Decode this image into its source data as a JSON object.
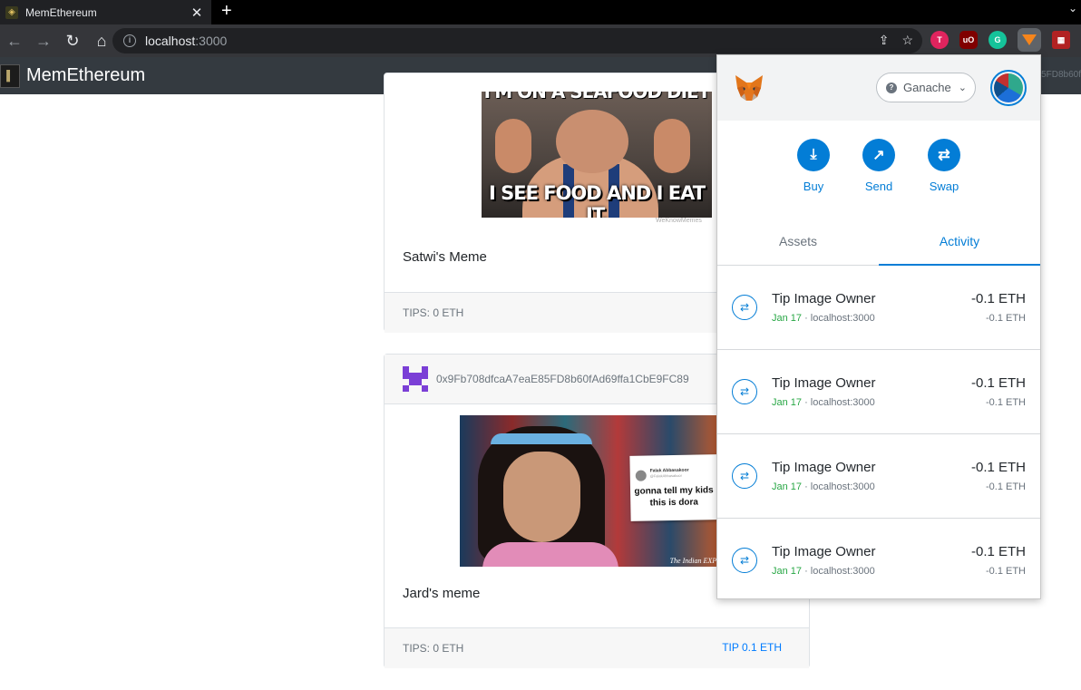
{
  "browser": {
    "tab_title": "MemEthereum",
    "tab_close": "✕",
    "new_tab": "+",
    "url_host": "localhost",
    "url_port": ":3000"
  },
  "app": {
    "brand": "MemEthereum",
    "nav_account_fragment": "5FD8b60f"
  },
  "posts": [
    {
      "meme_top_text": "I'M ON A SEAFOOD DIET",
      "meme_text": "I SEE FOOD AND I EAT IT.",
      "watermark": "WeKnowMemes",
      "caption": "Satwi's Meme",
      "tips": "TIPS: 0 ETH"
    },
    {
      "author_address": "0x9Fb708dfcaA7eaE85FD8b60fAd69ffa1CbE9FC89",
      "tweet_name": "Falak Abbasakoor",
      "tweet_handle": "@FalakAbbasakoor",
      "tweet_text_line1": "gonna tell my kids",
      "tweet_text_line2": "this is dora",
      "publisher_mark": "The Indian EXPR",
      "caption": "Jard's meme",
      "tips": "TIPS: 0 ETH",
      "tip_button": "TIP 0.1 ETH"
    }
  ],
  "metamask": {
    "network": "Ganache",
    "actions": [
      "Buy",
      "Send",
      "Swap"
    ],
    "tabs": [
      "Assets",
      "Activity"
    ],
    "active_tab": "Activity",
    "transactions": [
      {
        "title": "Tip Image Owner",
        "date": "Jan 17",
        "origin": " · localhost:3000",
        "amount": "-0.1 ETH",
        "amount_secondary": "-0.1 ETH"
      },
      {
        "title": "Tip Image Owner",
        "date": "Jan 17",
        "origin": " · localhost:3000",
        "amount": "-0.1 ETH",
        "amount_secondary": "-0.1 ETH"
      },
      {
        "title": "Tip Image Owner",
        "date": "Jan 17",
        "origin": " · localhost:3000",
        "amount": "-0.1 ETH",
        "amount_secondary": "-0.1 ETH"
      },
      {
        "title": "Tip Image Owner",
        "date": "Jan 17",
        "origin": " · localhost:3000",
        "amount": "-0.1 ETH",
        "amount_secondary": "-0.1 ETH"
      }
    ]
  },
  "colors": {
    "metamask_blue": "#037dd6",
    "app_navbar": "#343a40",
    "link_blue": "#007bff",
    "tx_date_green": "#28a745"
  }
}
